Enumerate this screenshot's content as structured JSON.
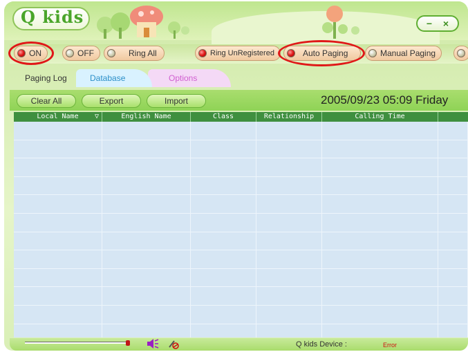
{
  "app": {
    "title": "Q kids"
  },
  "window_controls": {
    "minimize": "−",
    "close": "×"
  },
  "modes": {
    "on": "ON",
    "off": "OFF",
    "ring_all": "Ring All",
    "ring_unregistered": "Ring UnRegistered",
    "auto_paging": "Auto Paging",
    "manual_paging": "Manual Paging"
  },
  "tabs": [
    {
      "label": "Paging Log"
    },
    {
      "label": "Database"
    },
    {
      "label": "Options"
    }
  ],
  "actions": {
    "clear_all": "Clear All",
    "export": "Export",
    "import": "Import"
  },
  "datetime": "2005/09/23  05:09  Friday",
  "table": {
    "columns": [
      {
        "label": "Local Name",
        "sort": "▽"
      },
      {
        "label": "English Name"
      },
      {
        "label": "Class"
      },
      {
        "label": "Relationship"
      },
      {
        "label": "Calling Time"
      },
      {
        "label": ""
      }
    ],
    "rows": []
  },
  "status": {
    "device_label": "Q kids Device :",
    "device_status": "Error"
  },
  "colors": {
    "accent_green": "#8fd356",
    "header_green": "#3f8f3f",
    "error_red": "#d01010",
    "highlight_red": "#e01818"
  },
  "icons": [
    "speaker-icon",
    "microphone-muted-icon",
    "minimize-icon",
    "close-icon"
  ]
}
